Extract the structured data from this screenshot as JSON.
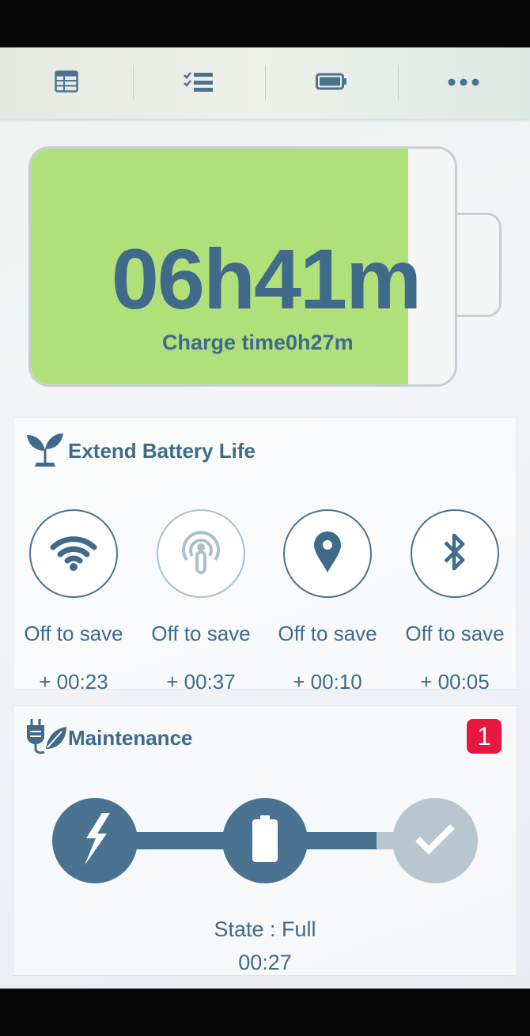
{
  "toolbar": {
    "items": [
      {
        "icon": "table-icon"
      },
      {
        "icon": "checklist-icon"
      },
      {
        "icon": "battery-icon"
      },
      {
        "icon": "more-icon"
      }
    ]
  },
  "battery": {
    "time_remaining": "06h41m",
    "charge_time": "Charge time0h27m",
    "fill_percent": 89,
    "fill_color": "#b0e07a"
  },
  "extend": {
    "title": "Extend Battery Life",
    "items": [
      {
        "icon": "wifi-icon",
        "label": "Off to save",
        "time": "+ 00:23"
      },
      {
        "icon": "hotspot-icon",
        "label": "Off to save",
        "time": "+ 00:37"
      },
      {
        "icon": "location-icon",
        "label": "Off to save",
        "time": "+ 00:10"
      },
      {
        "icon": "bluetooth-icon",
        "label": "Off to save",
        "time": "+ 00:05"
      }
    ]
  },
  "maintenance": {
    "title": "Maintenance",
    "badge": "1",
    "state": "State : Full",
    "time": "00:27"
  },
  "colors": {
    "accent": "#3f6a8a",
    "badge": "#e8173f"
  }
}
